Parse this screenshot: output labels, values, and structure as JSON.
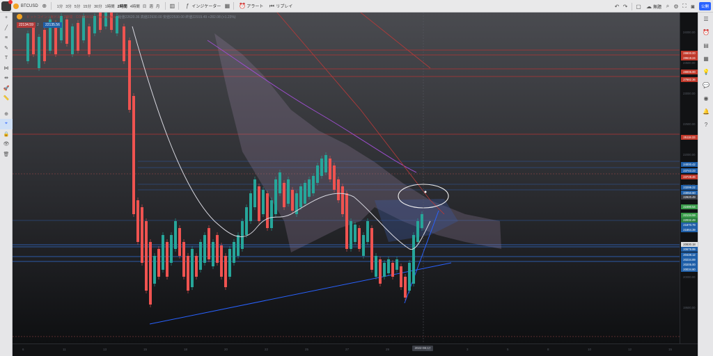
{
  "toolbar": {
    "symbol": "BTCUSD",
    "timeframes": [
      "1分",
      "3分",
      "5分",
      "15分",
      "30分",
      "1時間",
      "2時間",
      "4時間",
      "日",
      "週",
      "月"
    ],
    "active_timeframe": "2時間",
    "indicators_label": "インジケーター",
    "alert_label": "アラート",
    "replay_label": "リプレイ",
    "layout_label": "無題",
    "publish_label": "公開"
  },
  "legend": {
    "title": "ビットコイン / 米ドル · 2時間 · COINBASE · TradingView",
    "ohlc": "始値22620.36 高値22930.00 安値22530.00 終値22919.49 +282.08 (+1.23%)",
    "sell_price": "22134.59",
    "buy_price": "22135.56",
    "qty": "2"
  },
  "price_axis": {
    "ticks": [
      "24000.00",
      "23500.00",
      "23000.00",
      "22500.00",
      "22000.00",
      "21500.00",
      "21000.00",
      "20500.00",
      "20000.00",
      "19500.00"
    ],
    "labels": [
      {
        "text": "28800.00",
        "color": "#c0392b"
      },
      {
        "text": "28619.24",
        "color": "#c0392b"
      },
      {
        "text": "28006.00",
        "color": "#c0392b"
      },
      {
        "text": "27682.36",
        "color": "#c0392b"
      },
      {
        "text": "25118.33",
        "color": "#c0392b"
      },
      {
        "text": "24000.42",
        "color": "#1f5fa8"
      },
      {
        "text": "23743.23",
        "color": "#1f5fa8"
      },
      {
        "text": "23728.46",
        "color": "#c0392b"
      },
      {
        "text": "23299.22",
        "color": "#1f5fa8"
      },
      {
        "text": "23050.60",
        "color": "#1f5fa8"
      },
      {
        "text": "22920.49",
        "color": "#3a3d45"
      },
      {
        "text": "22490.54",
        "color": "#3a9b4a"
      },
      {
        "text": "22134.59",
        "color": "#3a9b4a"
      },
      {
        "text": "22032.49",
        "color": "#2a7f3e"
      },
      {
        "text": "21870.79",
        "color": "#1f5fa8"
      },
      {
        "text": "21664.39",
        "color": "#1f5fa8"
      },
      {
        "text": "20830.18",
        "color": "#e0e0e0"
      },
      {
        "text": "20679.99",
        "color": "#1f5fa8"
      },
      {
        "text": "20438.12",
        "color": "#1f5fa8"
      },
      {
        "text": "20234.89",
        "color": "#1f5fa8"
      },
      {
        "text": "20205.00",
        "color": "#1f5fa8"
      },
      {
        "text": "20034.80",
        "color": "#1f5fa8"
      }
    ]
  },
  "time_axis": {
    "ticks": [
      "6",
      "11",
      "13",
      "15",
      "18",
      "20",
      "22",
      "25",
      "27",
      "29",
      "8月",
      "3",
      "5",
      "8",
      "10",
      "12",
      "15"
    ],
    "cursor_date": "2022-08-12"
  },
  "colors": {
    "up": "#26a69a",
    "down": "#ef5350",
    "trendline": "#2962ff",
    "ma": "#d8d8e0",
    "ma_long": "#9c4dcc"
  },
  "icons": {
    "left": [
      "crosshair-icon",
      "trendline-icon",
      "fib-icon",
      "brush-icon",
      "text-icon",
      "pattern-icon",
      "measure-icon",
      "rocket-icon",
      "ruler-icon",
      "zoom-icon",
      "magnet-icon",
      "lock-icon",
      "eye-icon",
      "trash-icon"
    ],
    "right": [
      "watchlist-icon",
      "alert-icon",
      "data-window-icon",
      "calendar-icon",
      "idea-icon",
      "chat-icon",
      "stream-icon",
      "notification-icon",
      "help-icon"
    ]
  }
}
